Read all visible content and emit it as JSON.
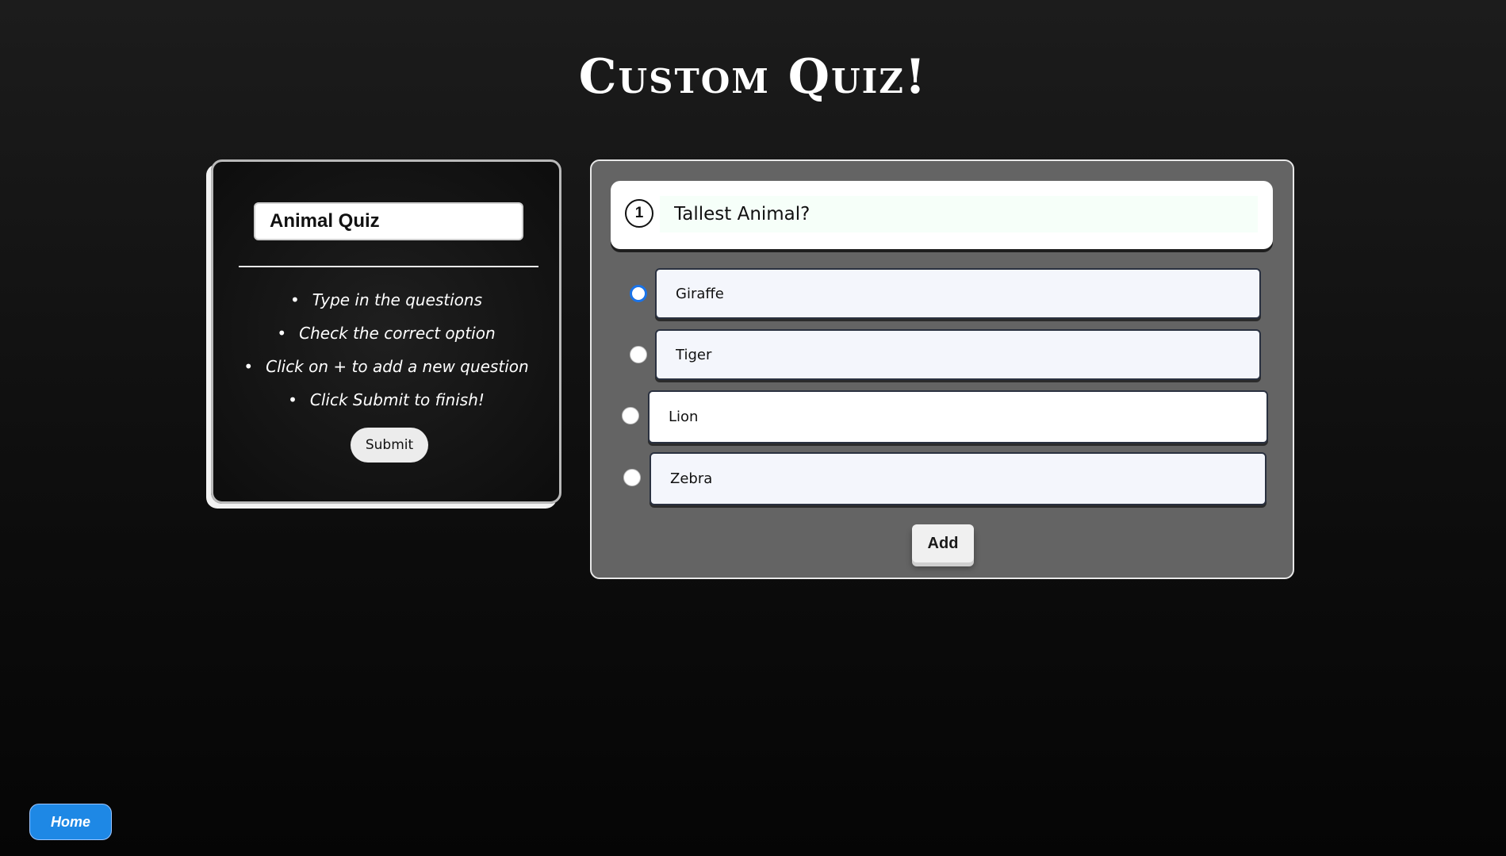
{
  "page": {
    "title": "Custom Quiz!"
  },
  "sidebar": {
    "quiz_name_value": "Animal Quiz",
    "instructions": [
      "Type in the questions",
      "Check the correct option",
      "Click on + to add a new question",
      "Click Submit to finish!"
    ],
    "submit_label": "Submit"
  },
  "question": {
    "number": "1",
    "text_value": "Tallest Animal?",
    "options": [
      {
        "value": "Giraffe",
        "checked": true
      },
      {
        "value": "Tiger",
        "checked": false
      },
      {
        "value": "Lion",
        "checked": false
      },
      {
        "value": "Zebra",
        "checked": false
      }
    ],
    "add_label": "Add"
  },
  "footer": {
    "home_label": "Home"
  },
  "colors": {
    "accent": "#1e88e5",
    "radio_checked": "#1a73e8",
    "right_panel_bg": "#646464"
  }
}
